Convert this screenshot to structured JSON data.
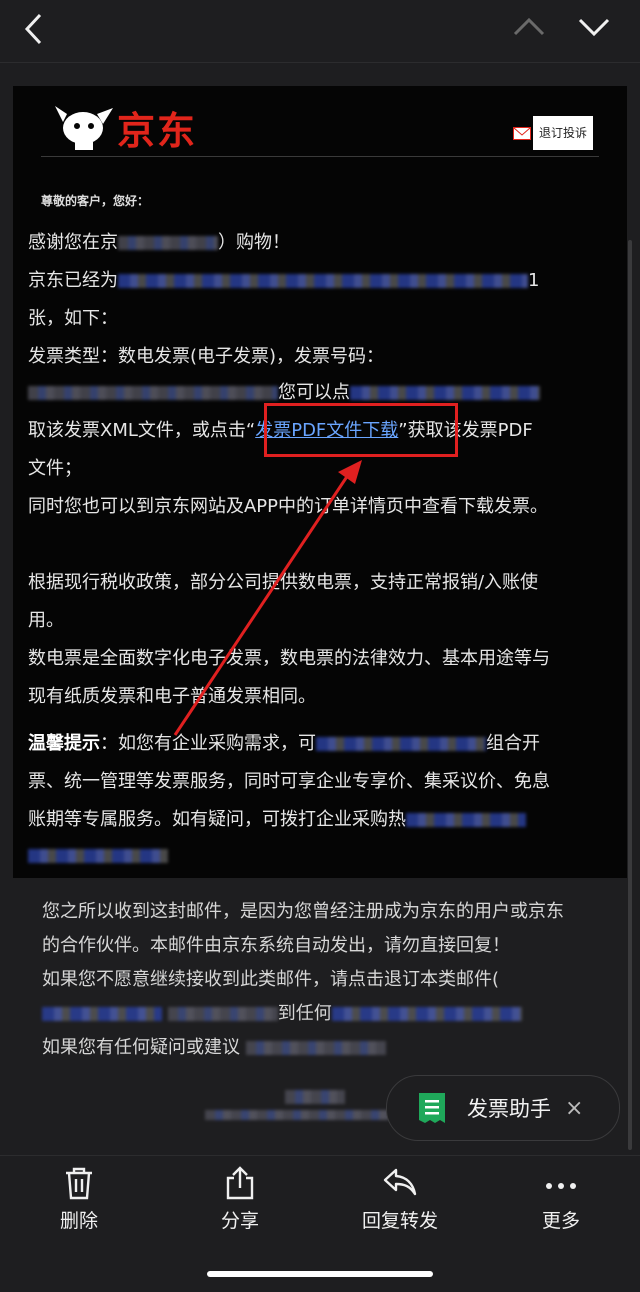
{
  "nav": {
    "back_icon": "chevron-left-icon",
    "prev_icon": "chevron-up-icon",
    "next_icon": "chevron-down-icon"
  },
  "email": {
    "brand": "京东",
    "unsubscribe_label": "退订投诉",
    "greeting": "尊敬的客户，您好：",
    "l1a": "感谢您在京",
    "l1b": "）购物！",
    "l2a": "京东已经为",
    "l2b": "1",
    "l3": "张，如下：",
    "l4": "发票类型：数电发票(电子发票)，发票号码：",
    "l5": "您可以点",
    "l6a": "取该发票XML文件，或点击“",
    "l6link": "发票PDF文件下载",
    "l6b": "”获取该发票PDF",
    "l7": "文件；",
    "l8": "同时您也可以到京东网站及APP中的订单详情页中查看下载发票。",
    "l9": "根据现行税收政策，部分公司提供数电票，支持正常报销/入账使",
    "l10": "用。",
    "l11": "数电票是全面数字化电子发票，数电票的法律效力、基本用途等与",
    "l12": "现有纸质发票和电子普通发票相同。",
    "l13bold": "温馨提示",
    "l13a": "：如您有企业采购需求，可",
    "l13b": "组合开",
    "l14": "票、统一管理等发票服务，同时可享企业专享价、集采议价、免息",
    "l15": "账期等专属服务。如有疑问，可拨打企业采购热"
  },
  "footer": {
    "f1": "您之所以收到这封邮件，是因为您曾经注册成为京东的用户或京东",
    "f2": "的合作伙伴。本邮件由京东系统自动发出，请勿直接回复！",
    "f3": "如果您不愿意继续接收到此类邮件，请点击退订本类邮件(",
    "f4": "到任何",
    "f5": "如果您有任何疑问或建议"
  },
  "helper": {
    "label": "发票助手",
    "icon": "receipt-icon",
    "close": "×"
  },
  "toolbar": {
    "delete": "删除",
    "share": "分享",
    "reply": "回复转发",
    "more": "更多"
  },
  "colors": {
    "brand": "#e1251b",
    "link": "#6aa5ff",
    "highlight": "#e02020"
  }
}
